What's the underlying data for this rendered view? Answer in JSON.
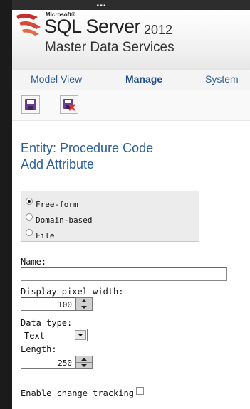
{
  "header": {
    "top_strip_text": "...",
    "vendor": "Microsoft®",
    "product": "SQL Server",
    "version": "2012",
    "subtitle": "Master Data Services"
  },
  "nav": {
    "items": [
      {
        "label": "Model View",
        "active": false
      },
      {
        "label": "Manage",
        "active": true
      },
      {
        "label": "System",
        "active": false
      }
    ]
  },
  "toolbar": {
    "buttons": [
      {
        "icon": "save-icon"
      },
      {
        "icon": "save-cancel-icon"
      }
    ]
  },
  "entity_title": "Entity: Procedure Code",
  "page_heading": "Add Attribute",
  "attribute_type": {
    "options": [
      {
        "label": "Free-form",
        "selected": true
      },
      {
        "label": "Domain-based",
        "selected": false
      },
      {
        "label": "File",
        "selected": false
      }
    ]
  },
  "form": {
    "name_label": "Name:",
    "name_value": "",
    "display_width_label": "Display pixel width:",
    "display_width_value": "100",
    "data_type_label": "Data type:",
    "data_type_value": "Text",
    "length_label": "Length:",
    "length_value": "250",
    "change_tracking_label": "Enable change tracking",
    "change_tracking_checked": false
  },
  "colors": {
    "link": "#2f5c91",
    "heading": "#2a5f9a",
    "save_icon": "#6a3d8f",
    "cancel_mark": "#e53935"
  }
}
